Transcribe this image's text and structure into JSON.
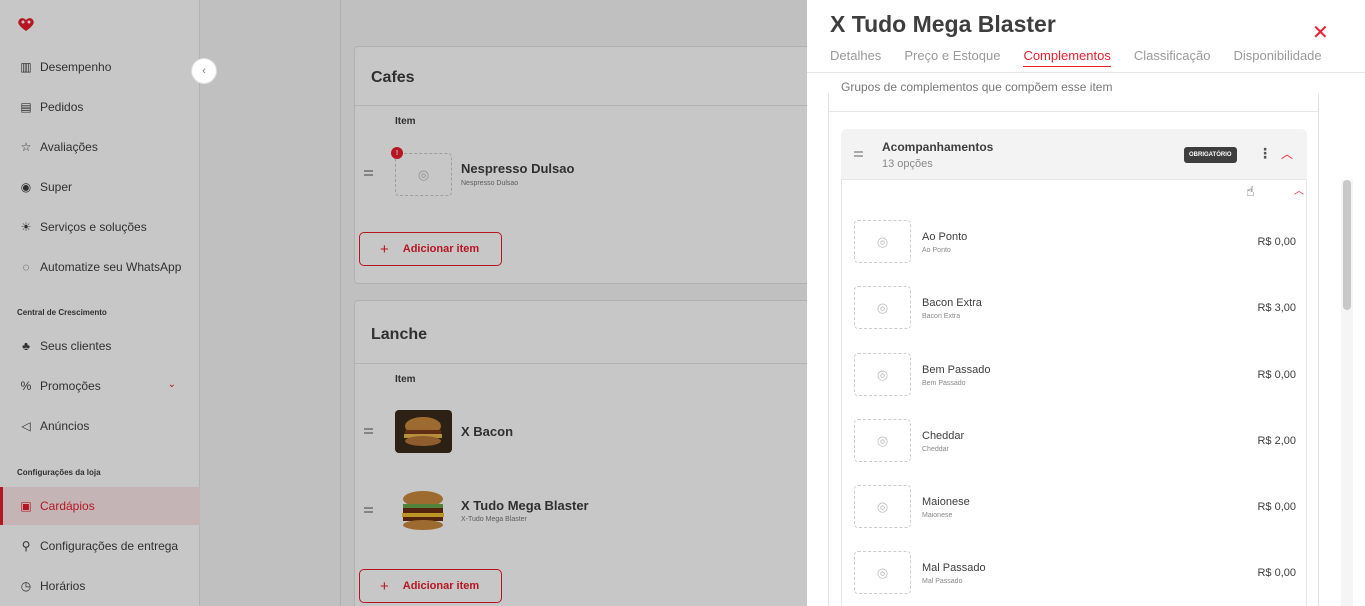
{
  "sidebar": {
    "collapse_icon": "chevron-left-icon",
    "items": [
      {
        "label": "Desempenho",
        "icon": "chart-icon"
      },
      {
        "label": "Pedidos",
        "icon": "receipt-icon"
      },
      {
        "label": "Avaliações",
        "icon": "star-icon"
      },
      {
        "label": "Super",
        "icon": "target-icon"
      },
      {
        "label": "Serviços e soluções",
        "icon": "lightbulb-icon"
      },
      {
        "label": "Automatize seu WhatsApp",
        "icon": "whatsapp-icon"
      }
    ],
    "section_growth": "Central de Crescimento",
    "growth_items": [
      {
        "label": "Seus clientes",
        "icon": "people-icon"
      },
      {
        "label": "Promoções",
        "icon": "promo-icon"
      },
      {
        "label": "Anúncios",
        "icon": "megaphone-icon"
      }
    ],
    "section_store": "Configurações da loja",
    "store_items": [
      {
        "label": "Cardápios",
        "icon": "menu-book-icon",
        "active": true
      },
      {
        "label": "Configurações de entrega",
        "icon": "delivery-icon"
      },
      {
        "label": "Horários",
        "icon": "clock-icon"
      }
    ]
  },
  "categories": [
    {
      "title": "Cafes",
      "column_header": "Item",
      "items": [
        {
          "name": "Nespresso Dulsao",
          "subtitle": "Nespresso Dulsao",
          "badge": "!"
        }
      ],
      "add_label": "Adicionar item"
    },
    {
      "title": "Lanche",
      "column_header": "Item",
      "items": [
        {
          "name": "X Bacon",
          "subtitle": ""
        },
        {
          "name": "X Tudo Mega Blaster",
          "subtitle": "X-Tudo Mega Blaster"
        }
      ],
      "add_label": "Adicionar item"
    }
  ],
  "panel": {
    "title": "X Tudo Mega Blaster",
    "close_icon": "close-icon",
    "tabs": [
      "Detalhes",
      "Preço e Estoque",
      "Complementos",
      "Classificação",
      "Disponibilidade"
    ],
    "active_tab": "Complementos",
    "intro": "Grupos de complementos que compõem esse item",
    "group": {
      "name": "Acompanhamentos",
      "count": "13 opções",
      "required_badge": "OBRIGATÓRIO",
      "options": [
        {
          "name": "Ao Ponto",
          "sub": "Ao Ponto",
          "price": "R$ 0,00"
        },
        {
          "name": "Bacon Extra",
          "sub": "Bacon Extra",
          "price": "R$ 3,00"
        },
        {
          "name": "Bem Passado",
          "sub": "Bem Passado",
          "price": "R$ 0,00"
        },
        {
          "name": "Cheddar",
          "sub": "Cheddar",
          "price": "R$ 2,00"
        },
        {
          "name": "Maionese",
          "sub": "Maionese",
          "price": "R$ 0,00"
        },
        {
          "name": "Mal Passado",
          "sub": "Mal Passado",
          "price": "R$ 0,00"
        }
      ]
    }
  },
  "colors": {
    "accent": "#ea1d2c",
    "text": "#3e3e3e"
  }
}
